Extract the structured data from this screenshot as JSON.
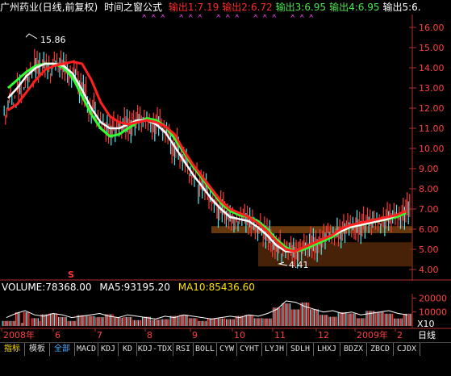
{
  "title": {
    "stock": "广州药业(日线,前复权)",
    "indicator": "时间之窗公式",
    "outputs": [
      {
        "label": "输出1:",
        "value": "7.19",
        "color": "#ff2a2a"
      },
      {
        "label": "输出2:",
        "value": "6.72",
        "color": "#ff2a2a"
      },
      {
        "label": "输出3:",
        "value": "6.95",
        "color": "#49e849"
      },
      {
        "label": "输出4:",
        "value": "6.95",
        "color": "#49e849"
      },
      {
        "label": "输出5:",
        "value": "6.",
        "color": "#ffffff"
      }
    ]
  },
  "chart_data": {
    "type": "line",
    "price_axis": {
      "ticks": [
        "16.00",
        "15.00",
        "14.00",
        "13.00",
        "12.00",
        "11.00",
        "10.00",
        "9.00",
        "8.00",
        "7.00",
        "6.00",
        "5.00",
        "4.00"
      ],
      "ylim": [
        3.6,
        16.4
      ]
    },
    "annotations": [
      {
        "text": "15.86",
        "kind": "high"
      },
      {
        "text": "4.41",
        "kind": "low"
      },
      {
        "text": "S",
        "kind": "signal"
      }
    ],
    "series": [
      {
        "name": "MA-red",
        "color": "#ff2020",
        "values": [
          11.9,
          12.2,
          12.8,
          13.4,
          13.9,
          14.1,
          14.2,
          14.3,
          14.2,
          13.4,
          12.3,
          11.6,
          11.3,
          11.2,
          11.3,
          11.4,
          11.3,
          11.1,
          10.7,
          9.9,
          9.2,
          8.6,
          8.0,
          7.4,
          7.0,
          6.8,
          6.6,
          6.3,
          5.9,
          5.4,
          5.0,
          4.9,
          5.1,
          5.3,
          5.5,
          5.7,
          6.0,
          6.2,
          6.3,
          6.4,
          6.5,
          6.6,
          6.7,
          6.9
        ]
      },
      {
        "name": "MA-white",
        "color": "#ffffff",
        "values": [
          12.5,
          13.0,
          13.6,
          14.0,
          14.2,
          14.2,
          14.1,
          13.7,
          12.9,
          12.0,
          11.3,
          11.0,
          11.0,
          11.2,
          11.4,
          11.4,
          11.2,
          10.8,
          10.1,
          9.4,
          8.7,
          8.1,
          7.5,
          7.0,
          6.6,
          6.5,
          6.4,
          6.1,
          5.7,
          5.2,
          4.9,
          4.9,
          5.1,
          5.3,
          5.5,
          5.7,
          5.9,
          6.1,
          6.2,
          6.3,
          6.4,
          6.5,
          6.7,
          6.9
        ]
      },
      {
        "name": "MA-green",
        "color": "#30ff30",
        "values": [
          13.0,
          13.4,
          13.8,
          14.1,
          14.2,
          14.2,
          14.0,
          13.5,
          12.6,
          11.7,
          11.0,
          10.6,
          10.7,
          11.0,
          11.3,
          11.5,
          11.4,
          11.1,
          10.5,
          9.8,
          9.1,
          8.5,
          7.9,
          7.3,
          6.9,
          6.7,
          6.6,
          6.4,
          6.0,
          5.5,
          5.1,
          4.9,
          5.0,
          5.2,
          5.4,
          5.6,
          5.9,
          6.1,
          6.2,
          6.3,
          6.4,
          6.5,
          6.6,
          6.8
        ]
      }
    ],
    "volume": {
      "label": "VOLUME:",
      "value": "78368.00",
      "ma5_label": "MA5:",
      "ma5": "93195.20",
      "ma10_label": "MA10:",
      "ma10": "85436.60",
      "ticks": [
        "20000",
        "10000"
      ],
      "scale": "X10",
      "values": [
        6,
        9,
        11,
        8,
        7,
        9,
        8,
        6,
        7,
        8,
        9,
        7,
        6,
        8,
        7,
        6,
        5,
        7,
        6,
        8,
        7,
        6,
        5,
        6,
        7,
        6,
        8,
        7,
        9,
        12,
        18,
        17,
        14,
        12,
        10,
        11,
        9,
        10,
        8,
        9,
        10,
        11,
        9,
        8
      ]
    },
    "date_axis": {
      "labels": [
        "2008年",
        "6",
        "7",
        "8",
        "9",
        "10",
        "11",
        "12",
        "2009年",
        "2"
      ],
      "right_label": "日线"
    }
  },
  "tabs": [
    "指标",
    "模板",
    "全部",
    "MACD",
    "KDJ",
    "KD",
    "KDJ-TDX",
    "RSI",
    "BOLL",
    "CYW",
    "CYHT",
    "LYJH",
    "SDLH",
    "LHXJ",
    "BDZX",
    "ZBCD",
    "CJDX"
  ]
}
